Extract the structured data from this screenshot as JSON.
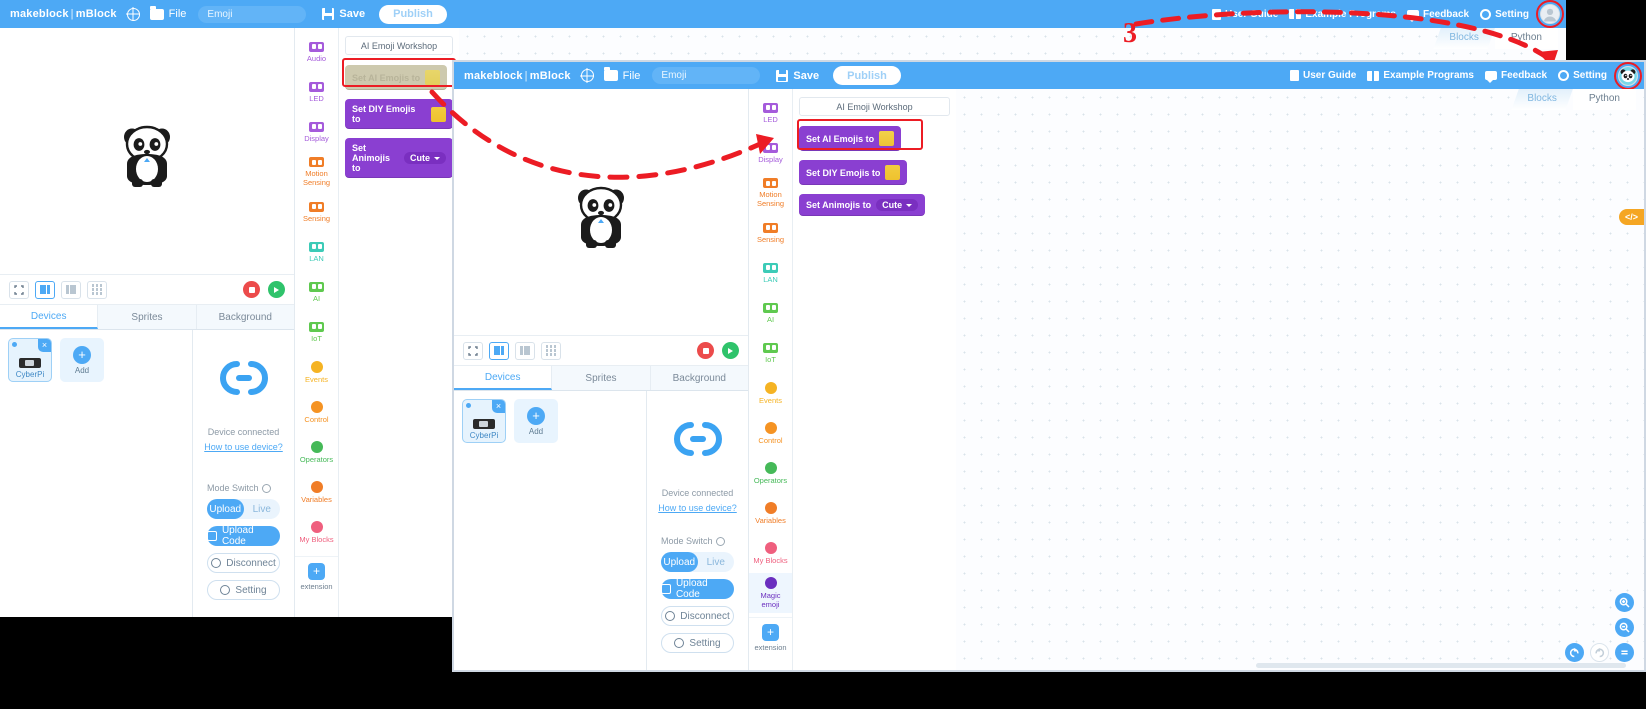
{
  "app": {
    "brand_left": "makeblock",
    "brand_sep": "|",
    "brand_right": "mBlock",
    "file_menu": "File",
    "project_name": "Emoji",
    "save_label": "Save",
    "publish_label": "Publish",
    "icons": {
      "globe": "globe-icon",
      "folder": "folder-icon",
      "disk": "save-disk-icon"
    }
  },
  "topbar_right": {
    "items": [
      {
        "label": "User Guide",
        "icon": "document-icon"
      },
      {
        "label": "Example Programs",
        "icon": "book-icon"
      },
      {
        "label": "Feedback",
        "icon": "chat-icon"
      },
      {
        "label": "Setting",
        "icon": "gear-icon"
      }
    ],
    "avatar_back": "default-user-avatar",
    "avatar_front": "panda-user-avatar"
  },
  "view_tabs": {
    "blocks": "Blocks",
    "python": "Python",
    "active": "Blocks"
  },
  "stage": {
    "sprite": "panda-sprite",
    "controls": {
      "fullscreen": "fullscreen-icon",
      "layout_small": "small-stage-icon",
      "layout_large": "large-stage-icon",
      "layout_grid": "grid-stage-icon",
      "stop": "stop-button",
      "start": "green-flag-button"
    }
  },
  "panel_tabs": {
    "items": [
      "Devices",
      "Sprites",
      "Background"
    ],
    "active": "Devices"
  },
  "devices": {
    "device_name": "CyberPi",
    "add_label": "Add",
    "add_symbol": "+",
    "close_symbol": "×",
    "status": "Device connected",
    "help_link": "How to use device?",
    "mode_switch_label": "Mode Switch",
    "mode_upload": "Upload",
    "mode_live": "Live",
    "upload_code": "Upload Code",
    "disconnect": "Disconnect",
    "setting": "Setting"
  },
  "categories_back": [
    {
      "label": "Audio",
      "color": "#a55bdb",
      "shape": "chip"
    },
    {
      "label": "LED",
      "color": "#a55bdb",
      "shape": "chip"
    },
    {
      "label": "Display",
      "color": "#a55bdb",
      "shape": "chip"
    },
    {
      "label": "Motion\nSensing",
      "color": "#f07d27",
      "shape": "chip"
    },
    {
      "label": "Sensing",
      "color": "#f07d27",
      "shape": "chip"
    },
    {
      "label": "LAN",
      "color": "#3ccbb7",
      "shape": "chip"
    },
    {
      "label": "AI",
      "color": "#5fc94f",
      "shape": "chip"
    },
    {
      "label": "IoT",
      "color": "#5fc94f",
      "shape": "chip"
    },
    {
      "label": "Events",
      "color": "#f5b323",
      "shape": "dot"
    },
    {
      "label": "Control",
      "color": "#f59323",
      "shape": "dot"
    },
    {
      "label": "Operators",
      "color": "#45b958",
      "shape": "dot"
    },
    {
      "label": "Variables",
      "color": "#f07d27",
      "shape": "dot"
    },
    {
      "label": "My Blocks",
      "color": "#ef5f7e",
      "shape": "dot"
    }
  ],
  "categories_front": [
    {
      "label": "LED",
      "color": "#a55bdb",
      "shape": "chip"
    },
    {
      "label": "Display",
      "color": "#a55bdb",
      "shape": "chip"
    },
    {
      "label": "Motion\nSensing",
      "color": "#f07d27",
      "shape": "chip"
    },
    {
      "label": "Sensing",
      "color": "#f07d27",
      "shape": "chip"
    },
    {
      "label": "LAN",
      "color": "#3ccbb7",
      "shape": "chip"
    },
    {
      "label": "AI",
      "color": "#5fc94f",
      "shape": "chip"
    },
    {
      "label": "IoT",
      "color": "#5fc94f",
      "shape": "chip"
    },
    {
      "label": "Events",
      "color": "#f5b323",
      "shape": "dot"
    },
    {
      "label": "Control",
      "color": "#f59323",
      "shape": "dot"
    },
    {
      "label": "Operators",
      "color": "#45b958",
      "shape": "dot"
    },
    {
      "label": "Variables",
      "color": "#f07d27",
      "shape": "dot"
    },
    {
      "label": "My Blocks",
      "color": "#ef5f7e",
      "shape": "dot"
    },
    {
      "label": "Magic\nemoji",
      "color": "#6b2fbf",
      "shape": "dot",
      "selected": true
    }
  ],
  "extension": {
    "label": "extension",
    "symbol": "+"
  },
  "palette": {
    "group_header": "AI Emoji Workshop",
    "blocks": [
      {
        "label": "Set AI Emojis to",
        "icon": "ai-emoji-swatch",
        "highlight": true
      },
      {
        "label": "Set DIY Emojis to",
        "icon": "diy-emoji-swatch"
      },
      {
        "label": "Set Animojis to",
        "dropdown": "Cute"
      }
    ]
  },
  "annotations": {
    "step_number": "3",
    "arrow_to_avatar": "red-dashed-arrow-to-avatar",
    "arrow_to_block": "red-dashed-arrow-to-ai-emoji-block"
  },
  "canvas_tools": {
    "code_toggle": "</>",
    "zoom_in": "zoom-in-button",
    "zoom_out": "zoom-out-button",
    "undo": "undo-button",
    "redo": "redo-button",
    "reset": "reset-zoom-button"
  }
}
